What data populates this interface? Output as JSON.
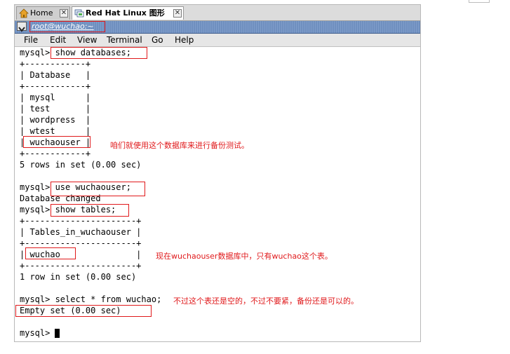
{
  "tabs": [
    {
      "label": "Home",
      "icon": "home-icon"
    },
    {
      "label": "Red Hat Linux 图形",
      "icon": "vm-icon"
    }
  ],
  "window": {
    "title": "root@wuchao:~"
  },
  "menu": [
    "File",
    "Edit",
    "View",
    "Terminal",
    "Go",
    "Help"
  ],
  "terminal": {
    "lines": [
      "mysql> show databases;",
      "+------------+",
      "| Database   |",
      "+------------+",
      "| mysql      |",
      "| test       |",
      "| wordpress  |",
      "| wtest      |",
      "| wuchaouser |",
      "+------------+",
      "5 rows in set (0.00 sec)",
      "",
      "mysql> use wuchaouser;",
      "Database changed",
      "mysql> show tables;",
      "+----------------------+",
      "| Tables_in_wuchaouser |",
      "+----------------------+",
      "| wuchao               |",
      "+----------------------+",
      "1 row in set (0.00 sec)",
      "",
      "mysql> select * from wuchao;",
      "Empty set (0.00 sec)",
      "",
      "mysql> "
    ]
  },
  "annotations": {
    "note1": "咱们就使用这个数据库来进行备份测试。",
    "note2": "现在wuchaouser数据库中，只有wuchao这个表。",
    "note3": "不过这个表还是空的，不过不要紧，备份还是可以的。"
  },
  "colors": {
    "annotation": "#e0191b",
    "titlebar": "#7393c5"
  }
}
